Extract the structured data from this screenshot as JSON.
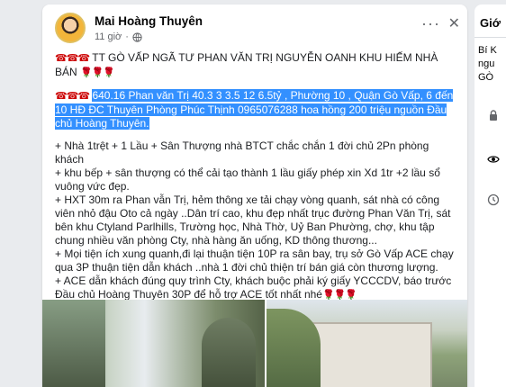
{
  "post": {
    "author": "Mai Hoàng Thuyên",
    "time": "11 giờ",
    "more_label": "···",
    "close_label": "✕",
    "title": "TT GÒ VẤP NGÃ TƯ PHAN VĂN TRỊ NGUYỄN OANH KHU HIẾM NHÀ BÁN",
    "title_emoji": "☎☎☎",
    "title_tail_emoji": "🌹🌹🌹",
    "highlight_emoji": "☎☎☎",
    "highlight_text": "640.16 Phan văn Trị 40.3  3  3.5 12  6.5tỷ , Phường 10 , Quận Gò Vấp, 6 đến 10 HĐ ĐC Thuyên Phòng Phúc Thịnh 0965076288  hoa hồng 200 triệu nguồn Đầu chủ Hoàng Thuyên.",
    "details": [
      "+ Nhà 1trệt + 1 Lầu + Sân Thượng nhà BTCT  chắc chắn 1 đời chủ 2Pn phòng khách",
      "+ khu bếp + sân thượng có thể cải tạo thành 1 lầu giấy phép xin Xd 1tr +2 lầu sổ vuông vức đẹp.",
      "+ HXT 30m ra Phan vẫn Trị,  hẻm thông xe tải chạy vòng quanh, sát nhà có công viên nhỏ đậu Oto cả ngày ..Dân trí cao, khu đẹp nhất trục đường Phan Văn Trị, sát bên khu Ctyland Parlhills, Trường học, Nhà Thờ, Uỷ Ban Phường, chợ, khu tập chung nhiều văn phòng Cty, nhà hàng ăn uống, KD thông thương...",
      "+ Mọi tiện ích xung quanh,đi lại thuận tiện 10P ra sân bay, trụ sở Gò Vấp ACE chạy qua 3P thuận tiện dẫn khách ..nhà 1 đời chủ thiện trí bán giá còn thương lượng.",
      "+ ACE dẫn khách đúng quy trình Cty, khách buộc phải ký giấy YCCCDV, báo trước Đầu chủ Hoàng Thuyên 30P để hỗ trợ ACE tốt nhất nhé"
    ],
    "details_tail_emoji": "🌹🌹🌹"
  },
  "sidebar": {
    "title": "Giớ",
    "lines": [
      "Bí K",
      "ngu",
      "GÒ"
    ]
  },
  "colors": {
    "highlight": "#3390ff",
    "background": "#e9ebee"
  }
}
